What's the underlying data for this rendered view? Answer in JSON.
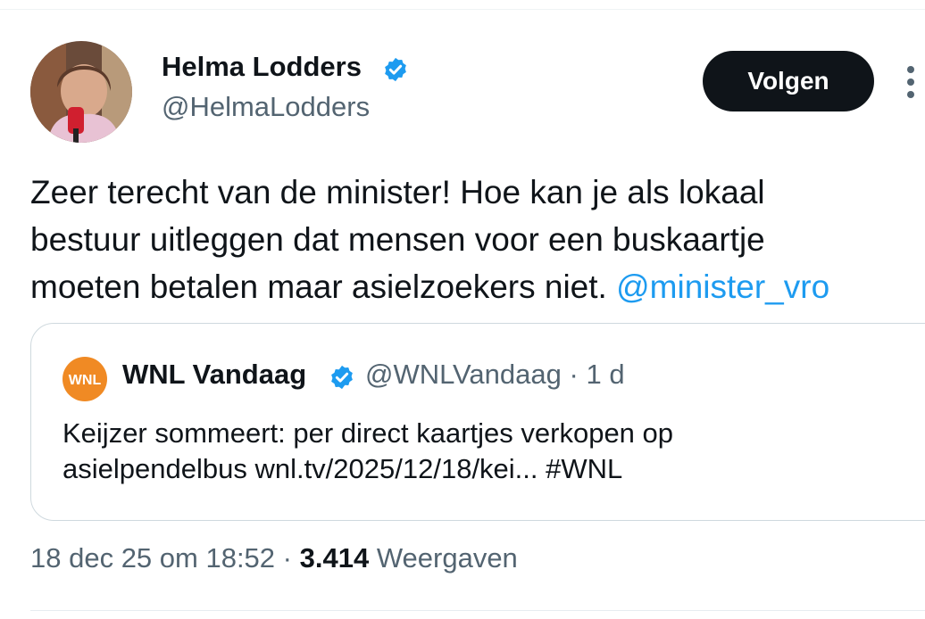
{
  "author": {
    "name": "Helma Lodders",
    "handle": "@HelmaLodders",
    "avatar_icon": "profile-photo",
    "verified_icon": "verified-badge-icon"
  },
  "actions": {
    "follow_label": "Volgen",
    "more_icon": "more-options-icon"
  },
  "tweet": {
    "lines": [
      "Zeer terecht van de minister! Hoe kan je als lokaal",
      "bestuur uitleggen dat mensen voor een buskaartje",
      "moeten betalen maar asielzoekers niet. "
    ],
    "mention": "@minister_vro"
  },
  "quote": {
    "name": "WNL Vandaag",
    "handle": "@WNLVandaag",
    "time_separator": "·",
    "time": "1 d",
    "logo_text": "WNL",
    "line1": "Keijzer sommeert: per direct kaartjes verkopen op",
    "line2_prefix": "asielpendelbus wnl.tv/2025/12/18/kei... ",
    "hashtag": "#WNL"
  },
  "meta": {
    "timestamp": "18 dec 25 om 18:52",
    "separator": "·",
    "views_count": "3.414",
    "views_label": "Weergaven"
  },
  "colors": {
    "accent": "#1d9bf0",
    "text": "#0f1419",
    "muted": "#536471",
    "border": "#cfd9de",
    "button_bg": "#0f1419",
    "logo_orange": "#f08a24"
  }
}
